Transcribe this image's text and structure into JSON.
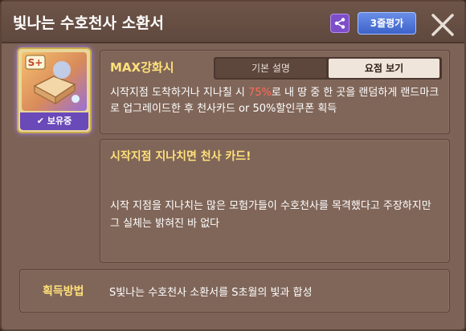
{
  "dialog": {
    "title": "빛나는 수호천사 소환서",
    "review_button": "3줄평가"
  },
  "item": {
    "badge": "S+",
    "owned_label": "보유중"
  },
  "special": {
    "title": "MAX강화시",
    "tabs": [
      "기본 설명",
      "요점 보기"
    ],
    "selected_tab": "요점 보기",
    "desc_before": "시작지점 도착하거나 지나칠 시 ",
    "desc_highlight": "75%",
    "desc_after": "로 내 땅 중 한 곳을 랜덤하게 랜드마크로 업그레이드한 후 천사카드 or 50%할인쿠폰 획득"
  },
  "event": {
    "title": "시작지점 지나치면 천사 카드!",
    "body": "시작 지점을 지나치는 많은 모험가들이 수호천사를 목격했다고 주장하지만 그 실체는 밝혀진 바 없다"
  },
  "acquire": {
    "label": "획득방법",
    "value": "S빛나는 수호천사 소환서를 S초월의 빛과 합성"
  },
  "colors": {
    "accent_yellow": "#ffe07a",
    "highlight_red": "#ff6b5a",
    "owned_purple": "#6a49b8",
    "review_blue": "#4a72d8"
  }
}
